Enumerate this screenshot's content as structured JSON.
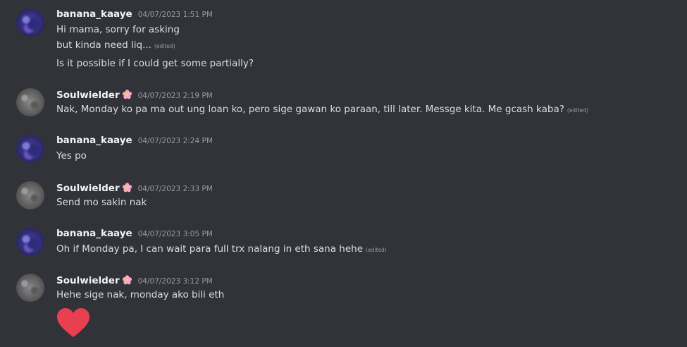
{
  "messages": [
    {
      "user": "banana_kaaye",
      "time": "04/07/2023 1:51 PM",
      "lines": [
        "Hi mama, sorry for asking",
        "but kinda need liq...",
        "Is it possible if I could get some partially?"
      ],
      "edited": "(edited)"
    },
    {
      "user": "Soulwielder",
      "time": "04/07/2023 2:19 PM",
      "lines": [
        "Nak, Monday ko pa ma out ung loan ko, pero sige gawan ko paraan, till later. Messge kita. Me gcash kaba?"
      ],
      "edited": "(edited)"
    },
    {
      "user": "banana_kaaye",
      "time": "04/07/2023 2:24 PM",
      "lines": [
        "Yes po"
      ]
    },
    {
      "user": "Soulwielder",
      "time": "04/07/2023 2:33 PM",
      "lines": [
        "Send mo sakin nak"
      ]
    },
    {
      "user": "banana_kaaye",
      "time": "04/07/2023 3:05 PM",
      "lines": [
        "Oh if Monday pa, I can wait para full trx nalang in eth sana hehe"
      ],
      "edited": "(edited)"
    },
    {
      "user": "Soulwielder",
      "time": "04/07/2023 3:12 PM",
      "lines": [
        "Hehe sige nak, monday ako bili eth"
      ],
      "emoji": "red-heart"
    }
  ],
  "colors": {
    "background": "#313338",
    "username": "#f2f3f5",
    "text": "#dbdee1",
    "muted": "#949ba4",
    "heart": "#e8404f",
    "flower": "#f7a8c8"
  }
}
